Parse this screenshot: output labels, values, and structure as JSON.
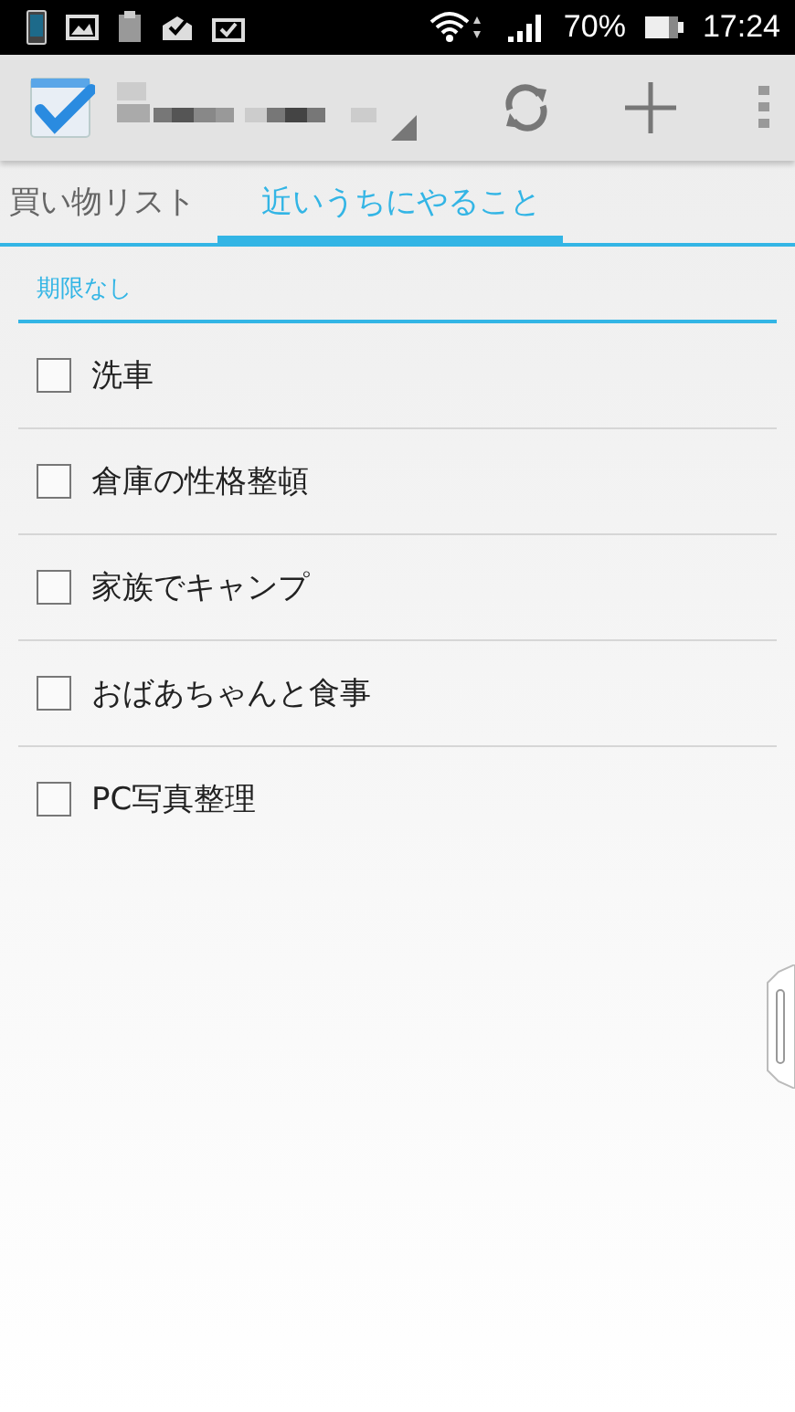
{
  "status_bar": {
    "battery": "70%",
    "time": "17:24"
  },
  "tabs": [
    {
      "label": "買い物リスト",
      "selected": false
    },
    {
      "label": "近いうちにやること",
      "selected": true
    }
  ],
  "section": {
    "title": "期限なし"
  },
  "tasks": [
    {
      "label": "洗車",
      "checked": false
    },
    {
      "label": "倉庫の性格整頓",
      "checked": false
    },
    {
      "label": "家族でキャンプ",
      "checked": false
    },
    {
      "label": "おばあちゃんと食事",
      "checked": false
    },
    {
      "label": "PC写真整理",
      "checked": false
    }
  ]
}
